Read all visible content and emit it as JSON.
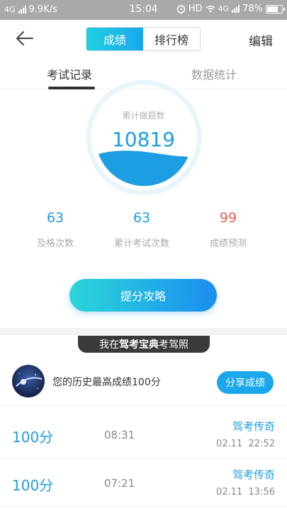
{
  "status_bar": {
    "network": "4G",
    "speed": "9.9K/s",
    "time": "15:04",
    "hd": "HD",
    "network2": "4G",
    "battery": "78%",
    "battery_level": 0.78
  },
  "header": {
    "segment_scores": "成绩",
    "segment_rank": "排行榜",
    "edit": "编辑"
  },
  "tabs": {
    "exam_records": "考试记录",
    "data_stats": "数据统计"
  },
  "summary": {
    "total_label": "累计做题数",
    "total_value": "10819",
    "stats": [
      {
        "value": "63",
        "label": "及格次数"
      },
      {
        "value": "63",
        "label": "累计考试次数"
      },
      {
        "value": "99",
        "label": "成绩预测"
      }
    ]
  },
  "cta": {
    "label": "提分攻略"
  },
  "banner": {
    "prefix": "我在",
    "brand": "驾考宝典",
    "suffix": "考驾照"
  },
  "best": {
    "text": "您的历史最高成绩100分",
    "share": "分享成绩"
  },
  "records": [
    {
      "score": "100分",
      "duration": "08:31",
      "title": "驾考传奇",
      "date": "02.11  22:52"
    },
    {
      "score": "100分",
      "duration": "07:21",
      "title": "驾考传奇",
      "date": "02.11  13:56"
    }
  ],
  "icons": {
    "back": "back-arrow-icon",
    "alarm": "alarm-icon",
    "wifi": "wifi-icon",
    "signal": "signal-icon",
    "battery": "battery-icon"
  },
  "colors": {
    "accent": "#1e9ee2",
    "accent_cyan": "#1fd0e0",
    "prediction": "#e2624f",
    "status_bar": "#a9a9a9"
  }
}
